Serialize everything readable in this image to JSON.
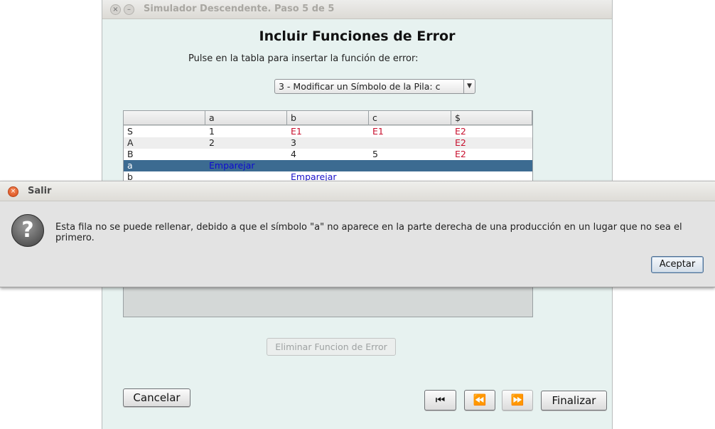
{
  "window": {
    "title": "Simulador Descendente. Paso 5 de 5",
    "close_glyph": "×",
    "minimize_glyph": "–"
  },
  "main": {
    "heading": "Incluir Funciones de Error",
    "instruction": "Pulse en la tabla para insertar la función de error:",
    "combo_selected": "3 - Modificar un Símbolo de la Pila: c",
    "combo_arrow": "▼"
  },
  "table": {
    "columns": [
      "",
      "a",
      "b",
      "c",
      "$"
    ],
    "rows": [
      {
        "cells": [
          "S",
          "1",
          "E1",
          "E1",
          "E2"
        ],
        "types": [
          "",
          "",
          "err",
          "err",
          "err"
        ]
      },
      {
        "cells": [
          "A",
          "2",
          "3",
          "",
          "E2"
        ],
        "types": [
          "",
          "",
          "",
          "",
          "err"
        ]
      },
      {
        "cells": [
          "B",
          "",
          "4",
          "5",
          "E2"
        ],
        "types": [
          "",
          "",
          "",
          "",
          "err"
        ]
      },
      {
        "cells": [
          "a",
          "Emparejar",
          "",
          "",
          ""
        ],
        "types": [
          "",
          "match",
          "",
          "",
          ""
        ],
        "selected": true
      },
      {
        "cells": [
          "b",
          "",
          "Emparejar",
          "",
          ""
        ],
        "types": [
          "",
          "",
          "match",
          "",
          ""
        ]
      }
    ]
  },
  "buttons": {
    "delete_error": "Eliminar Funcion de Error",
    "cancel": "Cancelar",
    "first": "⏮",
    "previous": "⏪",
    "next": "⏩",
    "finish": "Finalizar"
  },
  "dialog": {
    "title": "Salir",
    "close_glyph": "×",
    "icon": "question-icon",
    "icon_glyph": "?",
    "message": "Esta fila no se puede rellenar, debido a que el símbolo \"a\" no aparece en la parte derecha de una producción en un lugar que no sea el primero.",
    "accept": "Aceptar"
  }
}
